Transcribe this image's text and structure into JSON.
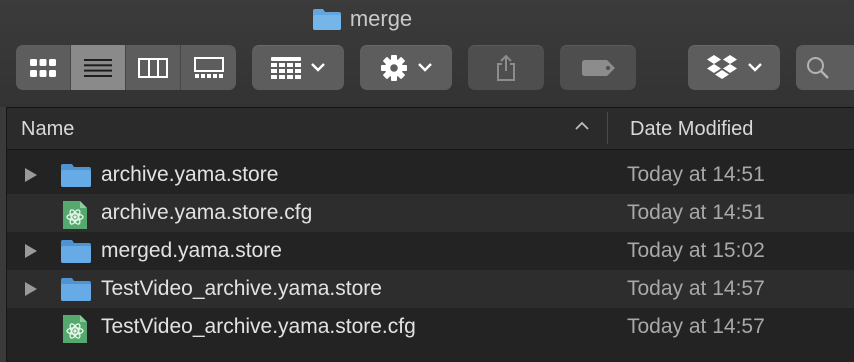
{
  "window": {
    "title": "merge"
  },
  "toolbar": {
    "view_modes": [
      "icon-view",
      "list-view",
      "column-view",
      "gallery-view"
    ],
    "active_view": "list-view",
    "buttons": [
      "group-by",
      "action-gear",
      "share",
      "tags",
      "dropbox",
      "search"
    ]
  },
  "columns": {
    "name": "Name",
    "date_modified": "Date Modified"
  },
  "files": [
    {
      "name": "archive.yama.store",
      "date": "Today at 14:51",
      "kind": "folder",
      "expandable": true
    },
    {
      "name": "archive.yama.store.cfg",
      "date": "Today at 14:51",
      "kind": "cfg",
      "expandable": false
    },
    {
      "name": "merged.yama.store",
      "date": "Today at 15:02",
      "kind": "folder",
      "expandable": true
    },
    {
      "name": "TestVideo_archive.yama.store",
      "date": "Today at 14:57",
      "kind": "folder",
      "expandable": true
    },
    {
      "name": "TestVideo_archive.yama.store.cfg",
      "date": "Today at 14:57",
      "kind": "cfg",
      "expandable": false
    }
  ],
  "colors": {
    "folder": "#62a6e0",
    "cfg_icon": "#4da667",
    "background": "#232323",
    "alt_row": "#2d2d2d"
  }
}
